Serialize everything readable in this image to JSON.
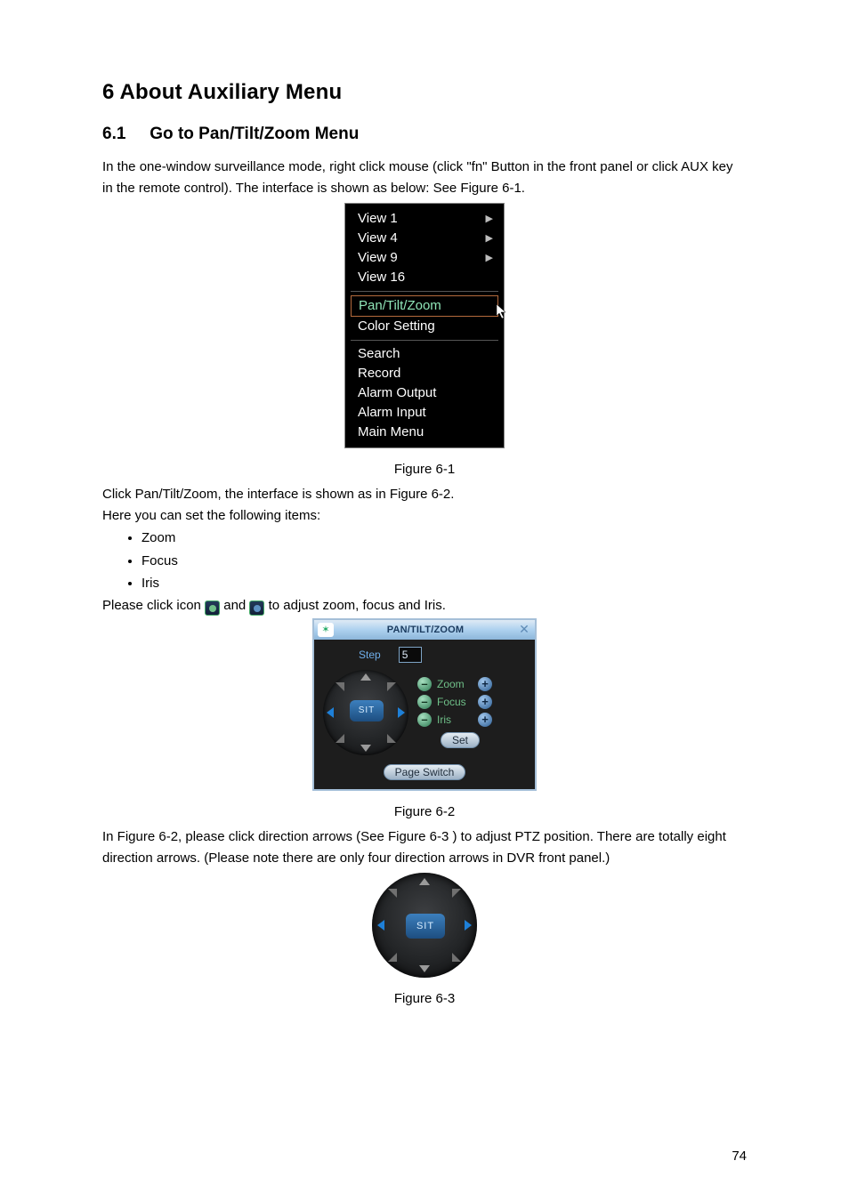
{
  "heading1": "6  About Auxiliary Menu",
  "heading2_num": "6.1",
  "heading2_text": "Go to Pan/Tilt/Zoom Menu",
  "para1": "In the one-window surveillance mode, right click mouse (click \"fn\" Button in the front panel or click AUX key in the remote control). The interface is shown as below: See Figure 6-1.",
  "ctx_menu": {
    "group1": [
      {
        "label": "View 1",
        "submenu": true
      },
      {
        "label": "View 4",
        "submenu": true
      },
      {
        "label": "View 9",
        "submenu": true
      },
      {
        "label": "View 16",
        "submenu": false
      }
    ],
    "group2": [
      {
        "label": "Pan/Tilt/Zoom",
        "highlight": true
      },
      {
        "label": "Color Setting"
      }
    ],
    "group3": [
      {
        "label": "Search"
      },
      {
        "label": "Record"
      },
      {
        "label": "Alarm Output"
      },
      {
        "label": "Alarm Input"
      },
      {
        "label": "Main Menu"
      }
    ]
  },
  "fig1_caption": "Figure 6-1",
  "para2": "Click Pan/Tilt/Zoom, the interface is shown as in Figure 6-2.",
  "para3": "Here you can set the following items:",
  "bullets": [
    "Zoom",
    "Focus",
    "Iris"
  ],
  "para4_prefix": "Please click icon ",
  "para4_mid": " and ",
  "para4_suffix": " to adjust zoom, focus and Iris.",
  "ptz": {
    "title": "PAN/TILT/ZOOM",
    "step_label": "Step",
    "step_value": "5",
    "center": "SIT",
    "rows": [
      {
        "label": "Zoom"
      },
      {
        "label": "Focus"
      },
      {
        "label": "Iris"
      }
    ],
    "set_button": "Set",
    "page_switch": "Page Switch"
  },
  "fig2_caption": "Figure 6-2",
  "para5": "In Figure 6-2, please click direction arrows (See Figure 6-3 ) to adjust PTZ position. There are totally eight direction arrows. (Please note there are only four direction arrows in DVR front panel.)",
  "dial_lg_center": "SIT",
  "fig3_caption": "Figure 6-3",
  "page_number": "74"
}
